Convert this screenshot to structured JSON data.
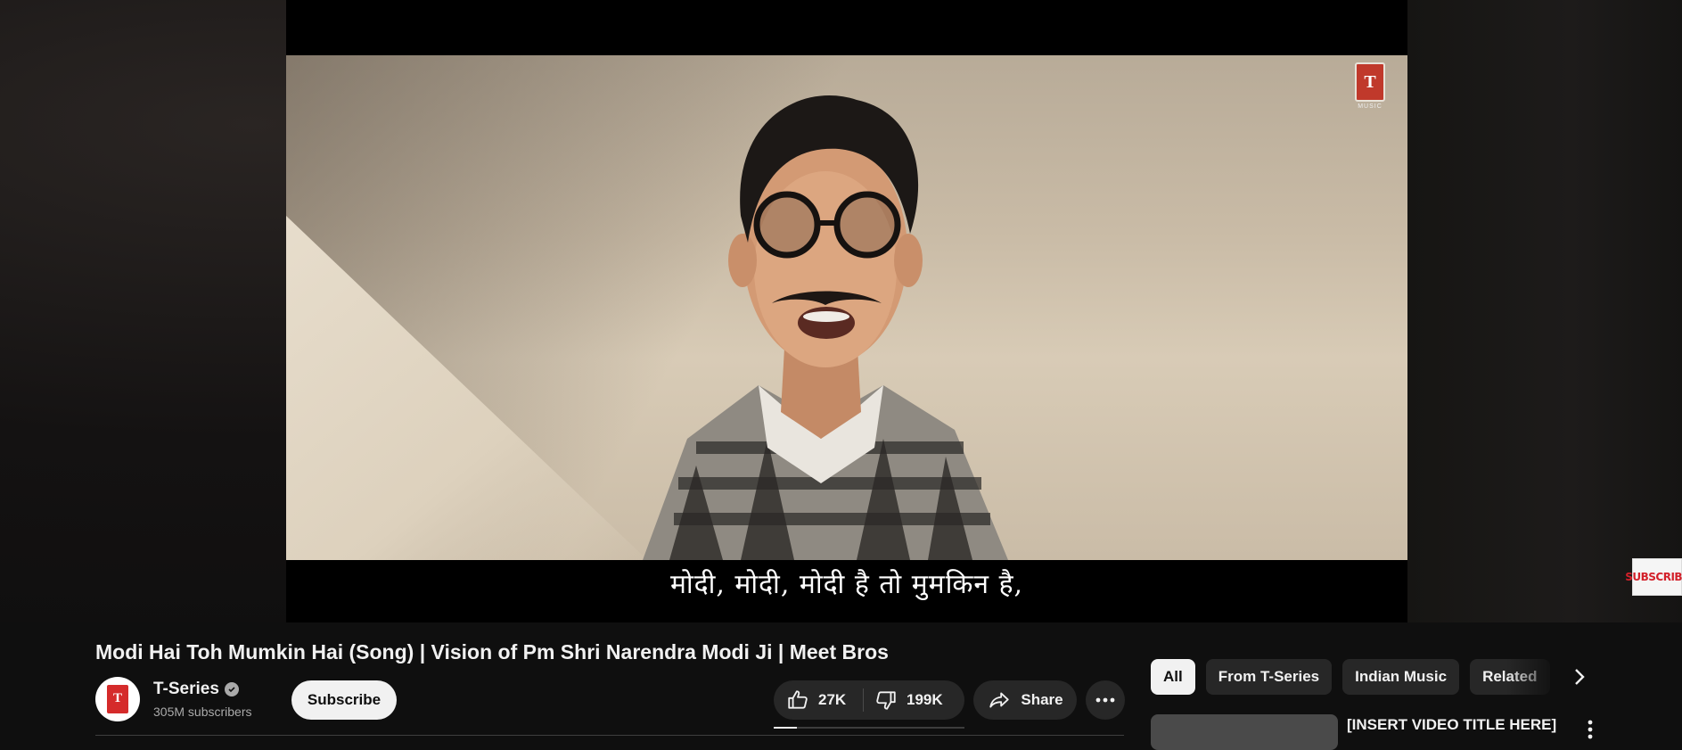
{
  "player": {
    "subtitle": "मोदी, मोदी, मोदी है तो मुमकिन है,",
    "watermark_logo": "T",
    "watermark_sub": "MUSIC",
    "subscribe_watermark": "SUBSCRIBE"
  },
  "video": {
    "title": "Modi Hai Toh Mumkin Hai (Song) | Vision of Pm Shri Narendra Modi Ji | Meet Bros"
  },
  "channel": {
    "name": "T-Series",
    "subscribers": "305M subscribers",
    "subscribe_label": "Subscribe",
    "avatar_letter": "T"
  },
  "actions": {
    "likes": "27K",
    "dislikes": "199K",
    "share_label": "Share",
    "like_ratio": 0.12
  },
  "sidebar": {
    "chips": [
      {
        "label": "All",
        "active": true
      },
      {
        "label": "From T-Series",
        "active": false
      },
      {
        "label": "Indian Music",
        "active": false
      },
      {
        "label": "Related",
        "active": false
      }
    ],
    "recommendations": [
      {
        "title": "[INSERT VIDEO TITLE HERE]"
      }
    ]
  },
  "icons": [
    "like-icon",
    "dislike-icon",
    "share-icon",
    "more-icon",
    "chevron-right-icon",
    "verified-icon",
    "kebab-menu-icon"
  ],
  "colors": {
    "background": "#0f0f0f",
    "pill": "#272727",
    "text": "#f1f1f1",
    "muted": "#aaaaaa",
    "brand_red": "#d52b2b"
  }
}
